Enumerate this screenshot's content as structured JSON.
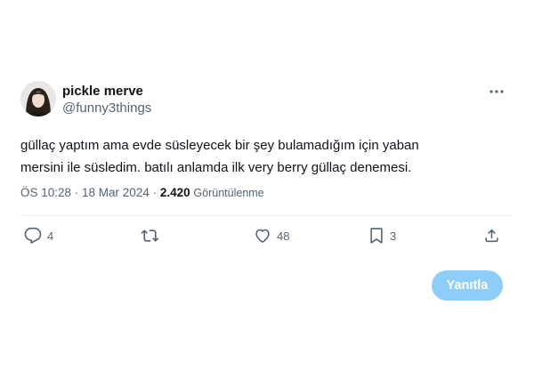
{
  "author": {
    "display_name": "pickle merve",
    "handle": "@funny3things"
  },
  "tweet": {
    "text_line_1": "güllaç yaptım ama evde süsleyecek bir şey bulamadığım için yaban",
    "text_line_2": "mersini ile süsledim. batılı anlamda ilk very berry güllaç denemesi.",
    "timestamp": "ÖS 10:28 · 18 Mar 2024 ·",
    "views_count": "2.420",
    "views_label": "Görüntülenme"
  },
  "actions": {
    "reply_count": "4",
    "retweet_count": "",
    "like_count": "48",
    "bookmark_count": "3"
  },
  "composer": {
    "reply_button_label": "Yanıtla"
  },
  "colors": {
    "text_primary": "#0f1419",
    "text_secondary": "#536471",
    "divider": "#eff3f4",
    "reply_button_disabled": "#8ecdf8"
  },
  "icons": [
    "more-icon",
    "reply-icon",
    "retweet-icon",
    "like-icon",
    "bookmark-icon",
    "share-icon"
  ]
}
